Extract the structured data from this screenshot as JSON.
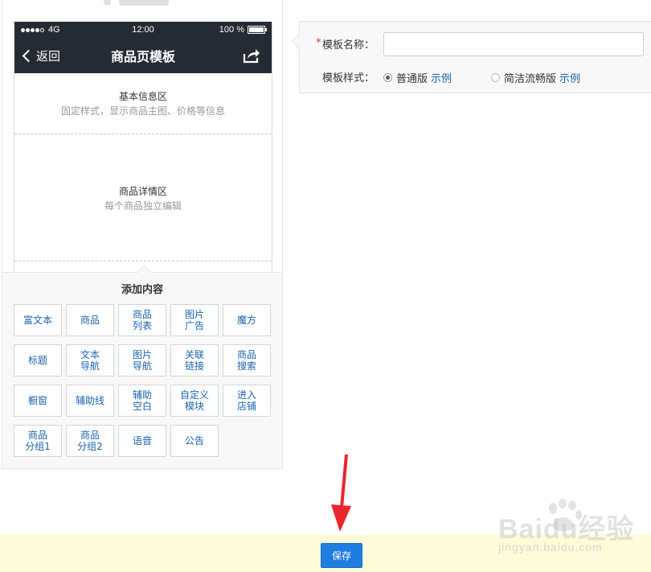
{
  "phone": {
    "status": {
      "carrier": "4G",
      "time": "12:00",
      "battery": "100 %"
    },
    "nav": {
      "back_label": "返回",
      "title": "商品页模板"
    },
    "sections": {
      "basic": {
        "title": "基本信息区",
        "subtitle": "固定样式，显示商品主图、价格等信息"
      },
      "detail": {
        "title": "商品详情区",
        "subtitle": "每个商品独立编辑"
      }
    }
  },
  "add_panel": {
    "title": "添加内容",
    "buttons": [
      "富文本",
      "商品",
      "商品\n列表",
      "图片\n广告",
      "魔方",
      "标题",
      "文本\n导航",
      "图片\n导航",
      "关联\n链接",
      "商品\n搜索",
      "橱窗",
      "辅助线",
      "辅助\n空白",
      "自定义\n模块",
      "进入\n店铺",
      "商品\n分组1",
      "商品\n分组2",
      "语音",
      "公告"
    ]
  },
  "form": {
    "required_mark": "*",
    "name_label": "模板名称：",
    "name_value": "",
    "style_label": "模板样式：",
    "options": [
      {
        "label": "普通版",
        "example": "示例",
        "selected": true
      },
      {
        "label": "简洁流畅版",
        "example": "示例",
        "selected": false
      }
    ]
  },
  "footer": {
    "save_label": "保存"
  },
  "watermark": {
    "logo_text": "Baidu经验",
    "url": "jingyan.baidu.com"
  },
  "colors": {
    "nav_bg": "#262a33",
    "link": "#1a63b0",
    "primary_button": "#1f7de0",
    "footer_bg": "#fdfbd8",
    "arrow": "#e8262d"
  }
}
